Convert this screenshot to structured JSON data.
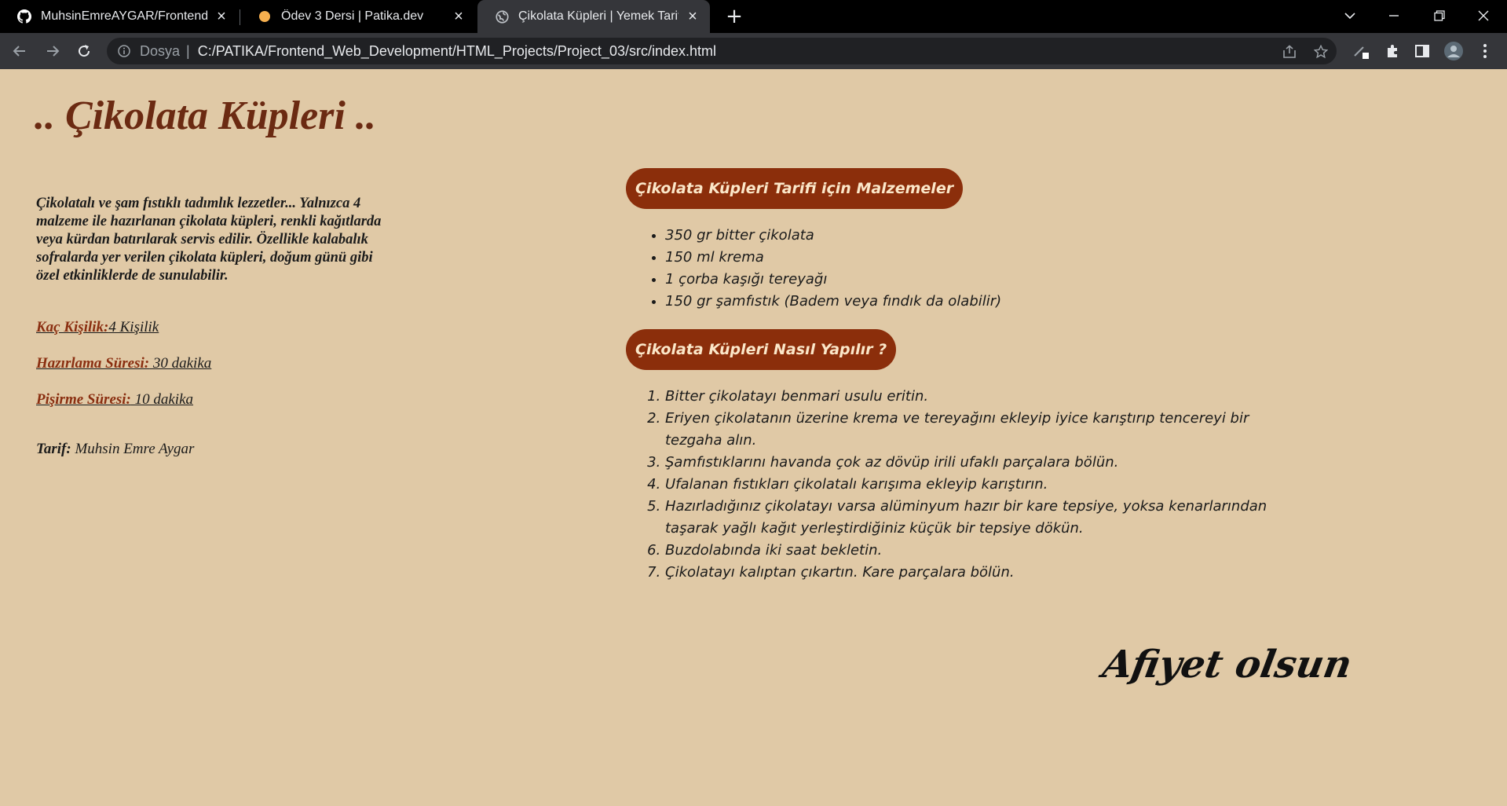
{
  "browser": {
    "tabs": [
      {
        "title": "MuhsinEmreAYGAR/Frontend_We",
        "favicon": "github-icon"
      },
      {
        "title": "Ödev 3 Dersi | Patika.dev",
        "favicon": "patika-icon"
      },
      {
        "title": "Çikolata Küpleri | Yemek Tarifleri",
        "favicon": "globe-icon"
      }
    ],
    "address_bar": {
      "label": "Dosya",
      "separator": "|",
      "url": "C:/PATIKA/Frontend_Web_Development/HTML_Projects/Project_03/src/index.html"
    }
  },
  "page": {
    "title": ".. Çikolata Küpleri ..",
    "intro": "Çikolatalı ve şam fıstıklı tadımlık lezzetler... Yalnızca 4 malzeme ile hazırlanan çikolata küpleri, renkli kağıtlarda veya kürdan batırılarak servis edilir. Özellikle kalabalık sofralarda yer verilen çikolata küpleri, doğum günü gibi özel etkinliklerde de sunulabilir.",
    "meta": [
      {
        "label": "Kaç Kişilik:",
        "value": "4 Kişilik"
      },
      {
        "label": "Hazırlama Süresi:",
        "value": " 30 dakika"
      },
      {
        "label": "Pişirme Süresi:",
        "value": " 10 dakika"
      }
    ],
    "author_label": "Tarif:",
    "author_name": " Muhsin Emre Aygar",
    "ingredients_heading": "Çikolata Küpleri Tarifi için Malzemeler",
    "ingredients": [
      "350 gr bitter çikolata",
      "150 ml krema",
      "1 çorba kaşığı tereyağı",
      "150 gr şamfıstık (Badem veya fındık da olabilir)"
    ],
    "steps_heading": "Çikolata Küpleri Nasıl Yapılır ?",
    "steps": [
      "Bitter çikolatayı benmari usulu eritin.",
      "Eriyen çikolatanın üzerine krema ve tereyağını ekleyip iyice karıştırıp tencereyi bir tezgaha alın.",
      "Şamfıstıklarını havanda çok az dövüp irili ufaklı parçalara bölün.",
      "Ufalanan fıstıkları çikolatalı karışıma ekleyip karıştırın.",
      "Hazırladığınız çikolatayı varsa alüminyum hazır bir kare tepsiye, yoksa kenarlarından taşarak yağlı kağıt yerleştirdiğiniz küçük bir tepsiye dökün.",
      "Buzdolabında iki saat bekletin.",
      "Çikolatayı kalıptan çıkartın. Kare parçalara bölün."
    ],
    "signoff": "Afiyet olsun"
  },
  "colors": {
    "page_bg": "#e0c9a6",
    "title": "#6b2a12",
    "pill_bg": "#8b2e0b",
    "pill_text": "#fbe7c9",
    "meta_label": "#8a2e10"
  }
}
